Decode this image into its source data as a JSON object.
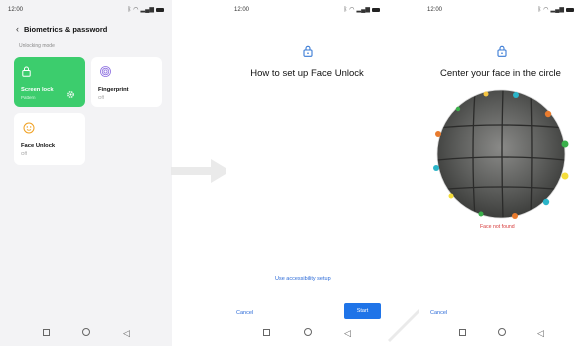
{
  "status": {
    "time": "12:00",
    "icons": [
      "bluetooth-icon",
      "wifi-icon",
      "signal-icon",
      "battery-icon"
    ]
  },
  "screen1": {
    "header_title": "Biometrics & password",
    "section_label": "Unlocking mode",
    "cards": {
      "screen_lock": {
        "title": "Screen lock",
        "subtitle": "Pattern"
      },
      "fingerprint": {
        "title": "Fingerprint",
        "subtitle": "Off"
      },
      "face_unlock": {
        "title": "Face Unlock",
        "subtitle": "Off"
      }
    }
  },
  "screen2": {
    "title": "How to set up Face Unlock",
    "accessibility_link": "Use accessibility setup",
    "cancel_label": "Cancel",
    "start_label": "Start"
  },
  "screen3": {
    "title": "Center your face in the circle",
    "error": "Face not found",
    "cancel_label": "Cancel"
  },
  "colors": {
    "accent": "#1f74e8",
    "green": "#3ccd6d",
    "error": "#d63a3a"
  }
}
